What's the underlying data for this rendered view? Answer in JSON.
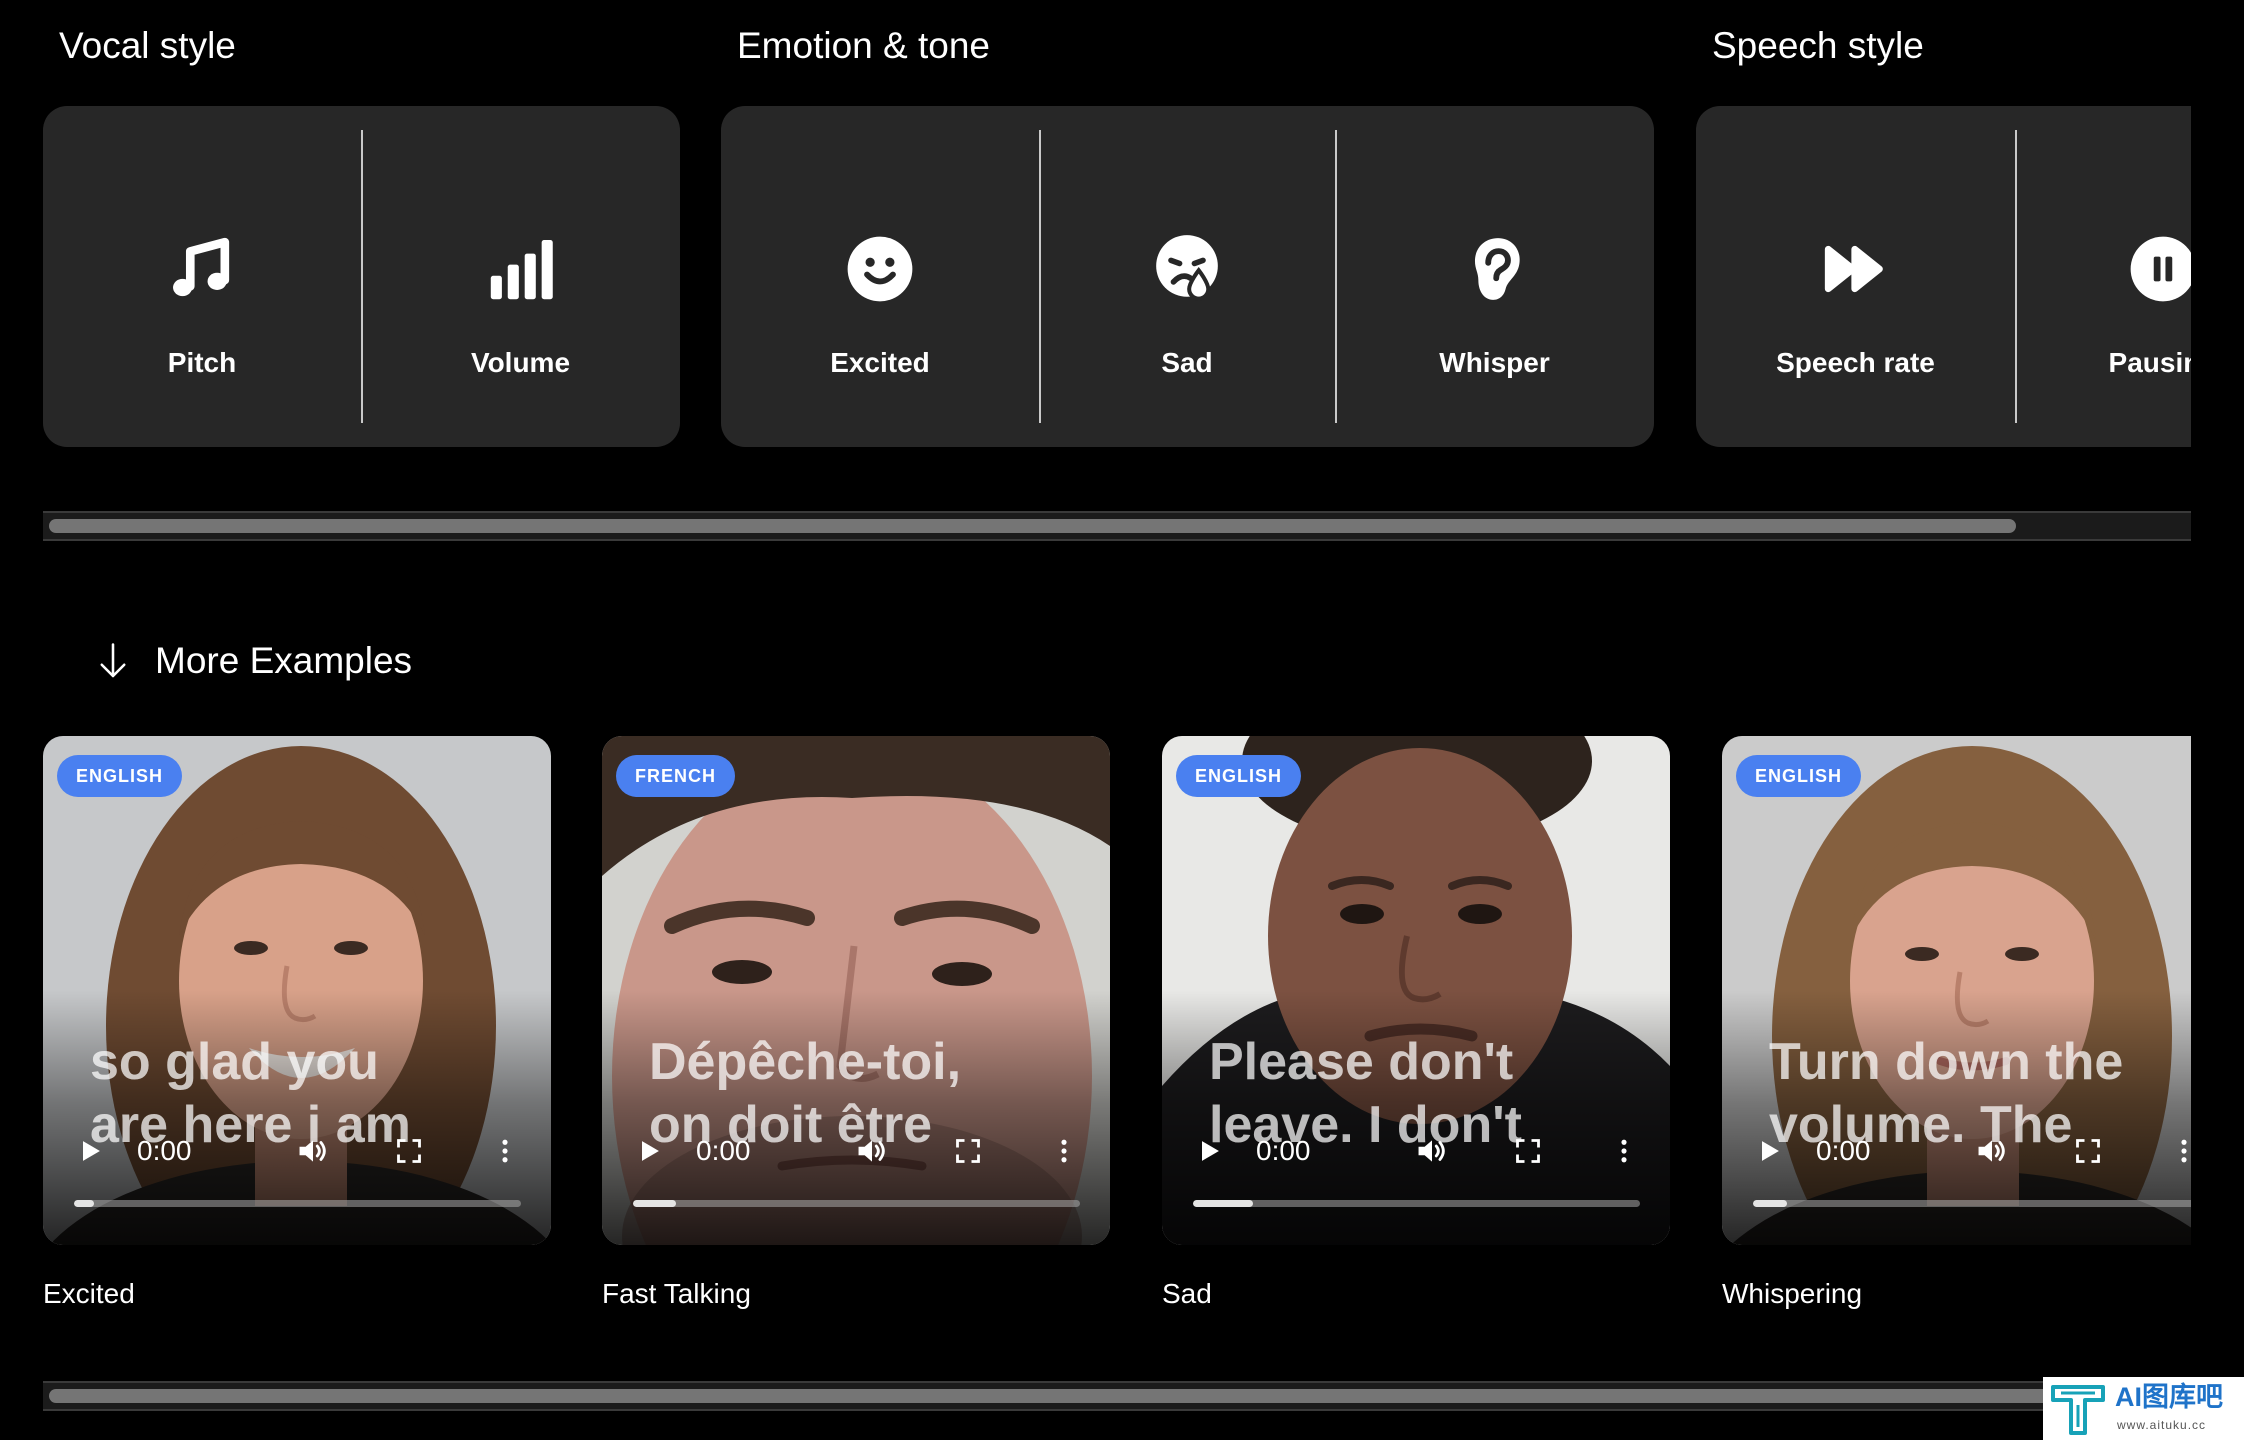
{
  "sections": [
    {
      "title": "Vocal style",
      "items": [
        {
          "label": "Pitch",
          "icon": "music-note-icon"
        },
        {
          "label": "Volume",
          "icon": "signal-bars-icon"
        }
      ]
    },
    {
      "title": "Emotion & tone",
      "items": [
        {
          "label": "Excited",
          "icon": "smiley-face-icon"
        },
        {
          "label": "Sad",
          "icon": "sad-face-tear-icon"
        },
        {
          "label": "Whisper",
          "icon": "ear-icon"
        }
      ]
    },
    {
      "title": "Speech style",
      "items": [
        {
          "label": "Speech rate",
          "icon": "fast-forward-icon"
        },
        {
          "label": "Pausing",
          "icon": "pause-circle-icon"
        }
      ]
    }
  ],
  "more_examples": {
    "label": "More Examples",
    "icon": "arrow-down-icon"
  },
  "examples": [
    {
      "language": "ENGLISH",
      "caption": [
        "so glad you",
        "are here i am"
      ],
      "time": "0:00",
      "progress": 0.045,
      "title": "Excited"
    },
    {
      "language": "FRENCH",
      "caption": [
        "Dépêche-toi,",
        "on doit être"
      ],
      "time": "0:00",
      "progress": 0.096,
      "title": "Fast Talking"
    },
    {
      "language": "ENGLISH",
      "caption": [
        "Please don't",
        "leave. I don't"
      ],
      "time": "0:00",
      "progress": 0.135,
      "title": "Sad"
    },
    {
      "language": "ENGLISH",
      "caption": [
        "Turn down the",
        "volume. The"
      ],
      "time": "0:00",
      "progress": 0.077,
      "title": "Whispering"
    }
  ],
  "player_icons": [
    "play-icon",
    "volume-icon",
    "fullscreen-icon",
    "more-options-icon"
  ],
  "watermark": {
    "name": "AI图库吧",
    "url": "www.aituku.cc"
  },
  "colors": {
    "background": "#000000",
    "card": "#272727",
    "divider": "#c9c9c9",
    "badge": "#4a80f0",
    "scroll_thumb": "#757575",
    "text": "#ffffff"
  }
}
